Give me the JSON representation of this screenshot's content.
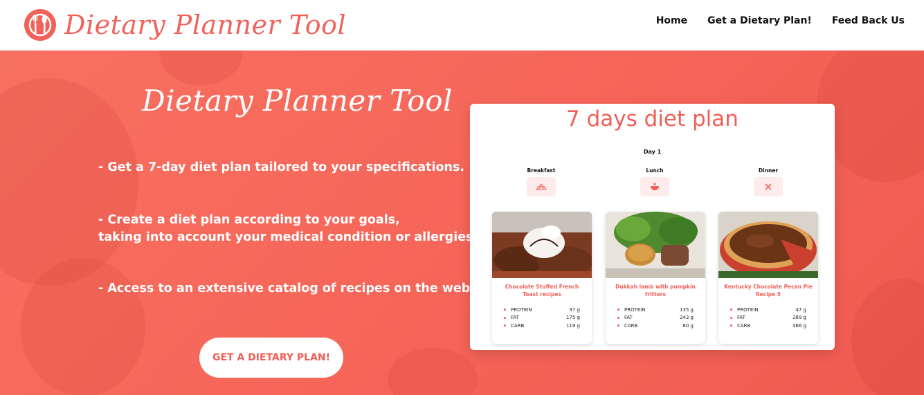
{
  "brand": {
    "name": "Dietary Planner Tool"
  },
  "nav": {
    "links": [
      "Home",
      "Get a Dietary Plan!",
      "Feed Back Us"
    ]
  },
  "hero": {
    "title": "Dietary Planner Tool",
    "bullets": [
      "- Get a 7-day diet plan tailored to your specifications.",
      "- Create a diet plan according to your goals,",
      "taking into account your medical condition or allergies",
      "- Access to an extensive catalog of recipes on the web"
    ],
    "cta": "GET A DIETARY PLAN!"
  },
  "plan": {
    "title": "7 days diet plan",
    "day": "Day 1",
    "meals": [
      {
        "name": "Breakfast",
        "icon": "breakfast-icon"
      },
      {
        "name": "Lunch",
        "icon": "bowl-icon"
      },
      {
        "name": "Dinner",
        "icon": "cutlery-icon"
      }
    ],
    "recipes": [
      {
        "name": "Chocolate Stuffed French Toast recipes",
        "protein": "37 g",
        "fat": "175 g",
        "carb": "119 g"
      },
      {
        "name": "Dukkah lamb with pumpkin fritters",
        "protein": "135 g",
        "fat": "243 g",
        "carb": "60 g"
      },
      {
        "name": "Kentucky Chocolate Pecan Pie Recipe 5",
        "protein": "47 g",
        "fat": "289 g",
        "carb": "466 g"
      }
    ],
    "nutrient_labels": [
      "PROTEIN",
      "FAT",
      "CARB"
    ]
  },
  "colors": {
    "accent": "#ef5f56",
    "hero_bg": "#f6675a"
  }
}
